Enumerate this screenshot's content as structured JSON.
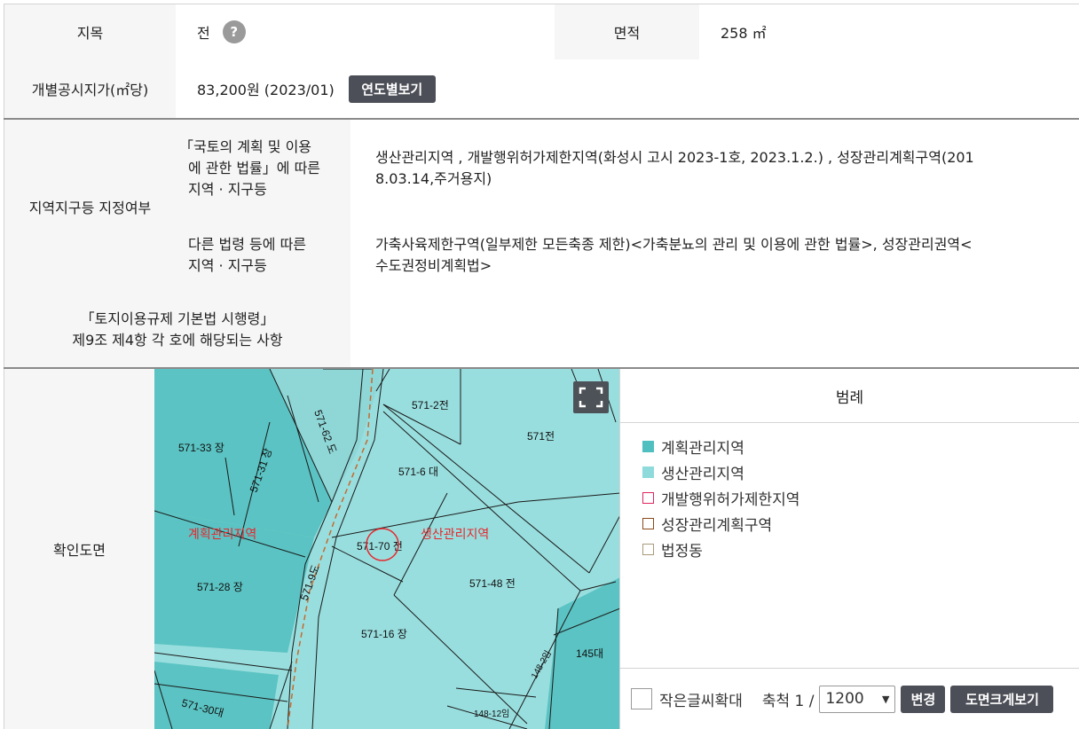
{
  "row1": {
    "jimok_label": "지목",
    "jimok_value": "전",
    "help_glyph": "?",
    "area_label": "면적",
    "area_value": "258 ㎡"
  },
  "row2": {
    "price_label": "개별공시지가(㎡당)",
    "price_value": "83,200원 (2023/01)",
    "yearly_button": "연도별보기"
  },
  "zoning": {
    "label": "지역지구등 지정여부",
    "sub1_label_line1": "「국토의 계획 및 이용",
    "sub1_label_line2": "에 관한 법률」에 따른",
    "sub1_label_line3": "지역 · 지구등",
    "sub1_value_line1": "생산관리지역 , 개발행위허가제한지역(화성시 고시 2023-1호, 2023.1.2.) , 성장관리계획구역(201",
    "sub1_value_line2": "8.03.14,주거용지)",
    "sub2_label_line1": "다른 법령 등에 따른",
    "sub2_label_line2": "지역 · 지구등",
    "sub2_value_line1": "가축사육제한구역(일부제한 모든축종 제한)<가축분뇨의 관리 및 이용에 관한 법률>, 성장관리권역<",
    "sub2_value_line2": "수도권정비계획법>"
  },
  "row4": {
    "label_line1": "「토지이용규제 기본법 시행령」",
    "label_line2": "제9조 제4항 각 호에 해당되는 사항",
    "value": ""
  },
  "map": {
    "label": "확인도면",
    "fullscreen_icon": "expand-icon",
    "parcels": [
      "571-2전",
      "571전",
      "571-33 장",
      "571-31 장",
      "571-62 도",
      "571-6 대",
      "571-70 전",
      "571-9도",
      "571-28 장",
      "571-48 전",
      "571-16 장",
      "145대",
      "571-30대",
      "148-12임",
      "148-2임"
    ],
    "zone_labels": [
      "계획관리지역",
      "생산관리지역"
    ],
    "colors": {
      "planning": "#5bc3c3",
      "production": "#99dede",
      "marker": "#e8262b"
    }
  },
  "legend": {
    "title": "범례",
    "items": [
      {
        "label": "계획관리지역",
        "color": "#4fbfbf",
        "filled": true
      },
      {
        "label": "생산관리지역",
        "color": "#8fdbdb",
        "filled": true
      },
      {
        "label": "개발행위허가제한지역",
        "color": "#e0245e",
        "filled": false
      },
      {
        "label": "성장관리계획구역",
        "color": "#8b4a1a",
        "filled": false
      },
      {
        "label": "법정동",
        "color": "#a89a7a",
        "filled": false
      }
    ]
  },
  "controls": {
    "small_text_label": "작은글씨확대",
    "scale_label": "축척 1 /",
    "scale_value": "1200",
    "change_button": "변경",
    "enlarge_button": "도면크게보기"
  }
}
